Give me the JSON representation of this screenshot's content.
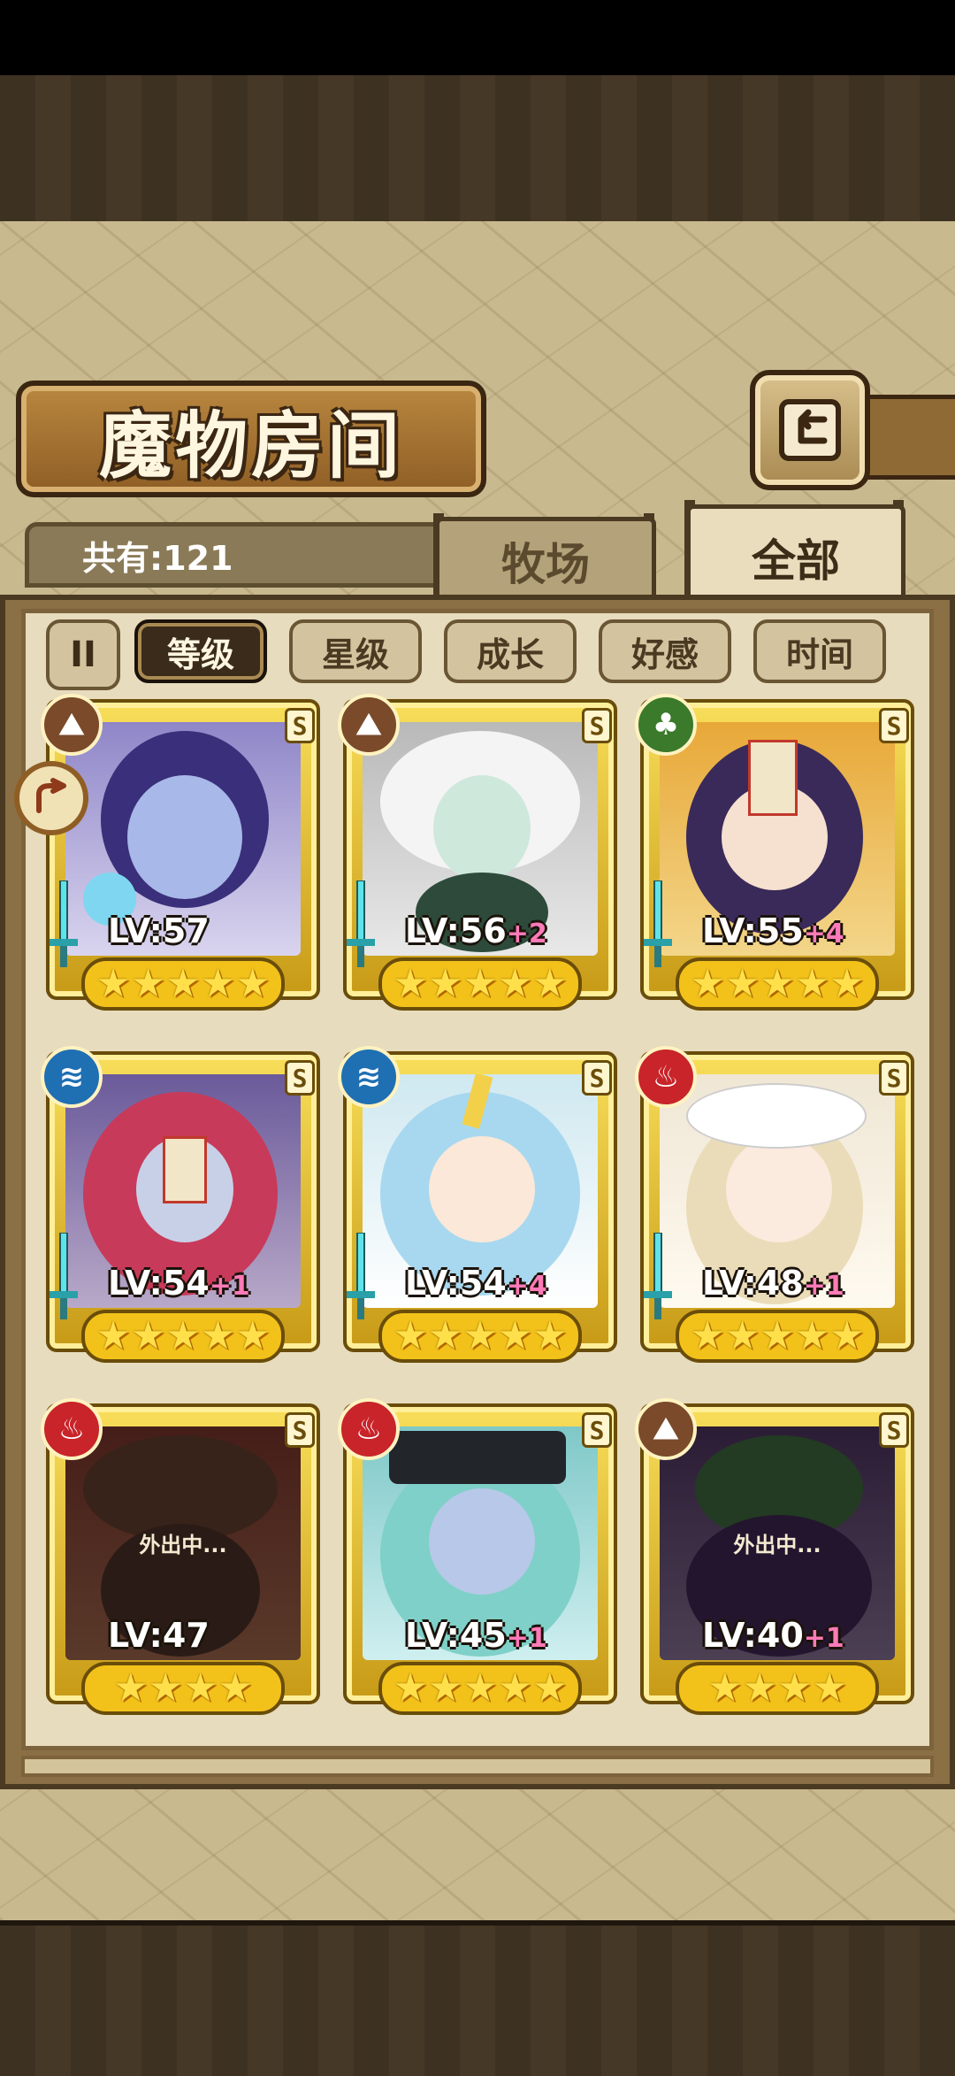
{
  "title": "魔物房间",
  "count_label": "共有:121",
  "tabs": {
    "farm": "牧场",
    "all": "全部"
  },
  "sort": {
    "toggle_icon": "II",
    "buttons": [
      "等级",
      "星级",
      "成长",
      "好感",
      "时间"
    ],
    "active": "等级"
  },
  "colors": {
    "earth": "#7a4a2a",
    "nature": "#3a7a2a",
    "water": "#1f6fb3",
    "fire": "#c8242a"
  },
  "monsters": [
    {
      "element": "earth",
      "element_icon": "⛰",
      "level": "LV:57",
      "plus": "",
      "stars": 5,
      "rank": "S",
      "out": ""
    },
    {
      "element": "earth",
      "element_icon": "⛰",
      "level": "LV:56",
      "plus": "+2",
      "stars": 5,
      "rank": "S",
      "out": ""
    },
    {
      "element": "nature",
      "element_icon": "♣",
      "level": "LV:55",
      "plus": "+4",
      "stars": 5,
      "rank": "S",
      "out": ""
    },
    {
      "element": "water",
      "element_icon": "≋",
      "level": "LV:54",
      "plus": "+1",
      "stars": 5,
      "rank": "S",
      "out": ""
    },
    {
      "element": "water",
      "element_icon": "≋",
      "level": "LV:54",
      "plus": "+4",
      "stars": 5,
      "rank": "S",
      "out": ""
    },
    {
      "element": "fire",
      "element_icon": "♨",
      "level": "LV:48",
      "plus": "+1",
      "stars": 5,
      "rank": "S",
      "out": ""
    },
    {
      "element": "fire",
      "element_icon": "♨",
      "level": "LV:47",
      "plus": "",
      "stars": 4,
      "rank": "S",
      "out": "外出中..."
    },
    {
      "element": "fire",
      "element_icon": "♨",
      "level": "LV:45",
      "plus": "+1",
      "stars": 5,
      "rank": "S",
      "out": ""
    },
    {
      "element": "earth",
      "element_icon": "⛰",
      "level": "LV:40",
      "plus": "+1",
      "stars": 4,
      "rank": "S",
      "out": "外出中..."
    }
  ]
}
